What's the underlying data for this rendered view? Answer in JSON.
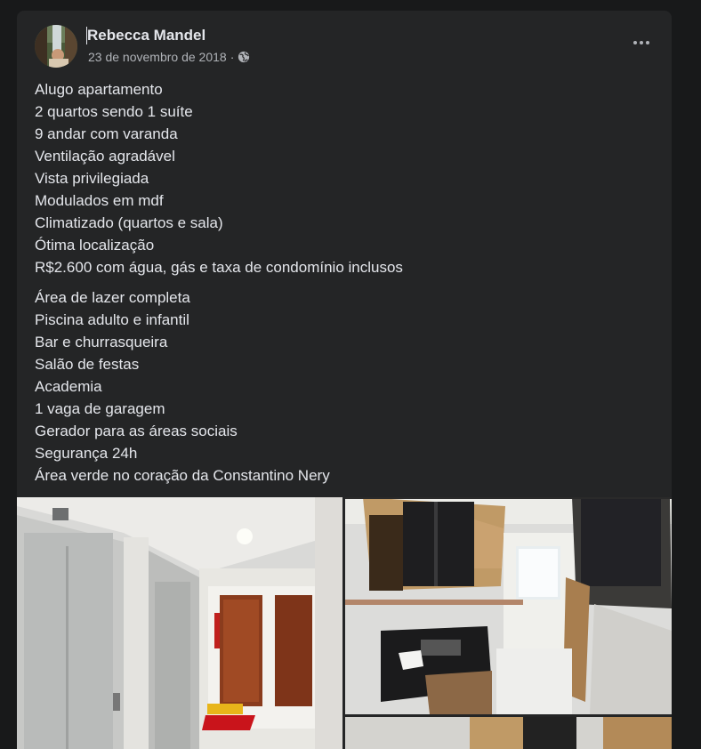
{
  "post": {
    "author": "Rebecca Mandel",
    "date": "23 de novembro de 2018",
    "separator": "·",
    "privacy_icon": "globe-icon",
    "more_icon": "more-options-icon",
    "paragraphs": [
      [
        "Alugo apartamento",
        "2 quartos sendo 1 suíte",
        "9 andar com varanda",
        "Ventilação agradável",
        "Vista privilegiada",
        "Modulados em mdf",
        "Climatizado (quartos e sala)",
        "Ótima localização",
        "R$2.600 com água, gás e taxa de condomínio inclusos"
      ],
      [
        "Área de lazer completa",
        "Piscina adulto e infantil",
        "Bar e churrasqueira",
        "Salão de festas",
        "Academia",
        "1 vaga de garagem",
        "Gerador para as áreas sociais",
        "Segurança 24h",
        "Área verde no coração da Constantino Nery"
      ]
    ],
    "photos": [
      {
        "subject": "elevator-hallway-photo"
      },
      {
        "subject": "kitchen-photo"
      },
      {
        "subject": "kitchen-photo-2"
      }
    ]
  },
  "colors": {
    "page_bg": "#18191a",
    "card_bg": "#242526",
    "primary_text": "#e4e6eb",
    "secondary_text": "#b0b3b8"
  }
}
